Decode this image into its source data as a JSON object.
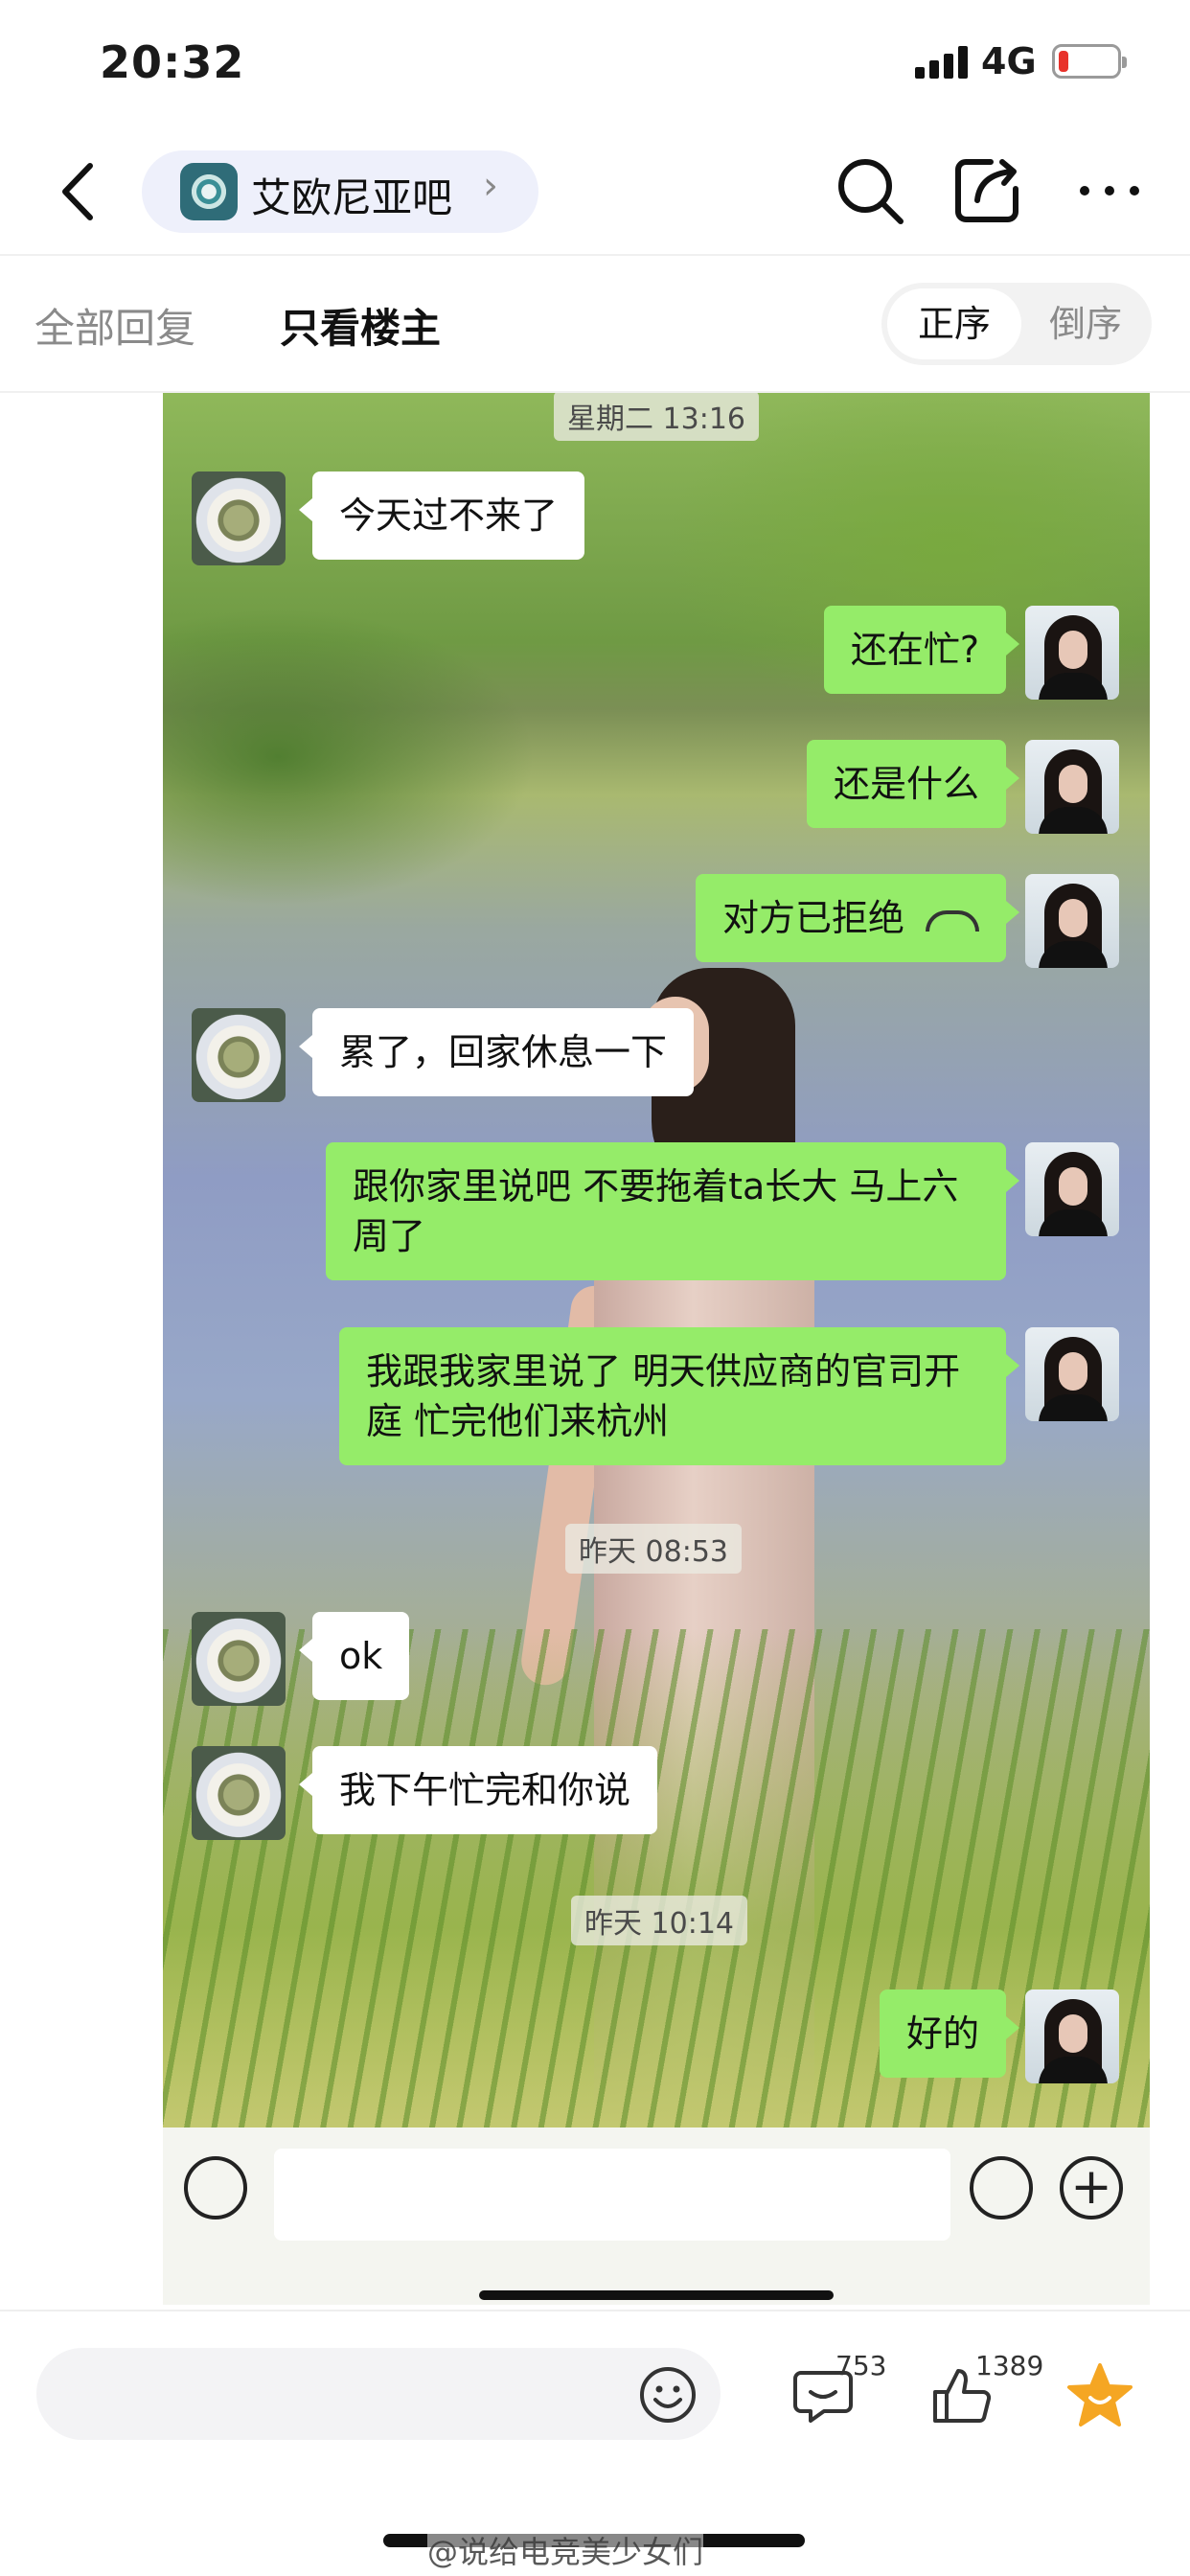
{
  "status": {
    "time": "20:32",
    "network": "4G"
  },
  "nav": {
    "forum_name": "艾欧尼亚吧",
    "chevron": "›"
  },
  "filter": {
    "tab_all": "全部回复",
    "tab_op": "只看楼主",
    "order_asc": "正序",
    "order_desc": "倒序"
  },
  "chat": {
    "messages": [
      {
        "kind": "timestamp",
        "text": "星期二 13:16"
      },
      {
        "kind": "in",
        "text": "今天过不来了"
      },
      {
        "kind": "out",
        "text": "还在忙?"
      },
      {
        "kind": "out",
        "text": "还是什么"
      },
      {
        "kind": "out",
        "text": "对方已拒绝"
      },
      {
        "kind": "in",
        "text": "累了，回家休息一下"
      },
      {
        "kind": "out",
        "text": "跟你家里说吧 不要拖着ta长大 马上六周了"
      },
      {
        "kind": "out",
        "text": "我跟我家里说了 明天供应商的官司开庭 忙完他们来杭州"
      },
      {
        "kind": "timestamp",
        "text": "昨天 08:53"
      },
      {
        "kind": "in",
        "text": "ok"
      },
      {
        "kind": "in",
        "text": "我下午忙完和你说"
      },
      {
        "kind": "timestamp",
        "text": "昨天 10:14"
      },
      {
        "kind": "out",
        "text": "好的"
      }
    ],
    "input_plus": "+"
  },
  "bottom": {
    "comment_count": "753",
    "like_count": "1389",
    "watermark": "@说给电竞美少女们"
  },
  "colors": {
    "outgoing_bubble": "#95ec69",
    "star": "#f5a623",
    "battery_low": "#e8322b"
  }
}
